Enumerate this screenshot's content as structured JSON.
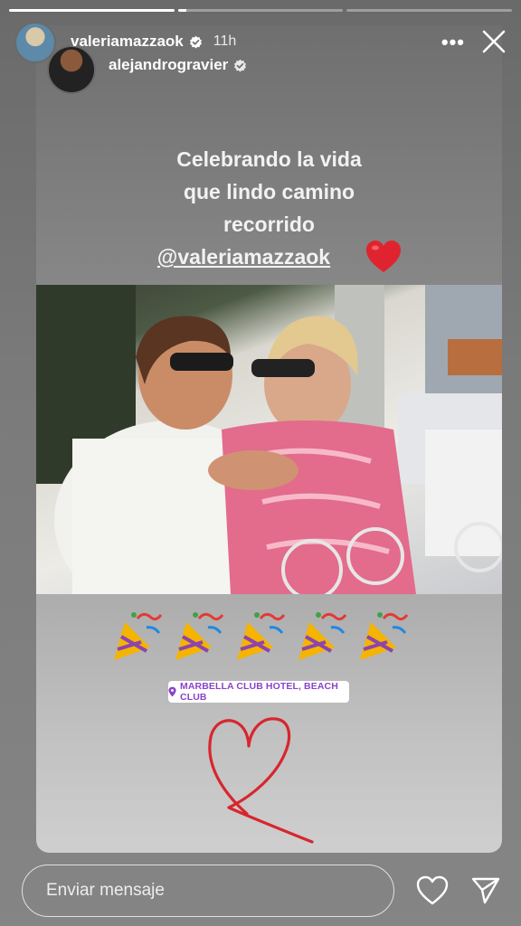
{
  "story": {
    "progress_segments": [
      1,
      0.05,
      0
    ],
    "primary_user": {
      "username": "valeriamazzaok",
      "verified": true,
      "time_ago": "11h"
    },
    "secondary_user": {
      "username": "alejandrogravier",
      "verified": true
    },
    "more_label": "•••",
    "caption_lines": [
      "Celebrando la vida",
      "que lindo camino",
      "recorrido"
    ],
    "mention": "@valeriamazzaok",
    "location_tag": "MARBELLA CLUB HOTEL, BEACH CLUB",
    "confetti_count": 5
  },
  "reply": {
    "placeholder": "Enviar mensaje"
  },
  "colors": {
    "heart_red": "#e0242f",
    "location_text": "#8a44c8",
    "drawn_heart": "#d8262e",
    "verified_badge": "#ffffff"
  },
  "icons": [
    "more-icon",
    "close-icon",
    "verified-icon",
    "heart-icon",
    "send-icon",
    "location-pin-icon",
    "party-popper-icon"
  ]
}
